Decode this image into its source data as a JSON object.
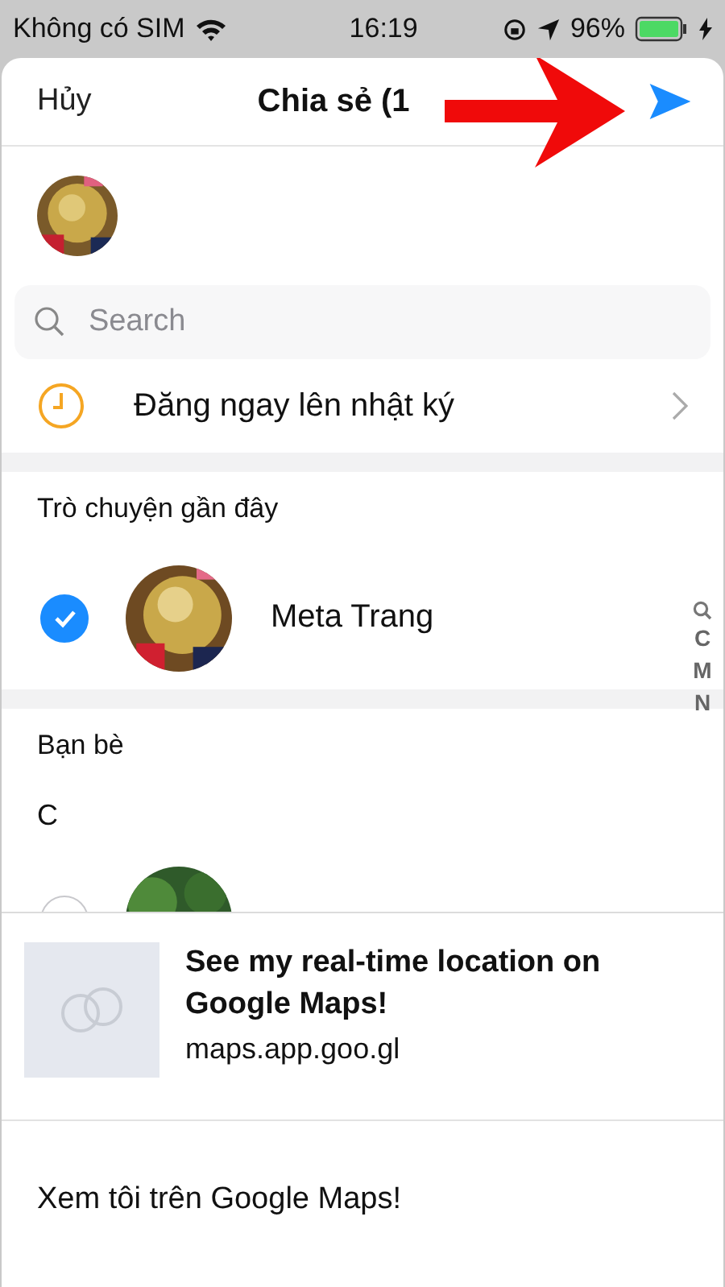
{
  "status_bar": {
    "carrier": "Không có SIM",
    "time": "16:19",
    "battery": "96%"
  },
  "header": {
    "cancel": "Hủy",
    "title": "Chia sẻ (1"
  },
  "search": {
    "placeholder": "Search"
  },
  "post_option": {
    "label": "Đăng ngay lên nhật ký"
  },
  "recent": {
    "title": "Trò chuyện gần đây",
    "contacts": [
      {
        "name": "Meta Trang",
        "selected": true
      }
    ]
  },
  "friends": {
    "title": "Bạn bè",
    "groups": [
      {
        "letter": "C",
        "contacts": [
          {
            "selected": false
          }
        ]
      }
    ]
  },
  "index": [
    "C",
    "M",
    "N"
  ],
  "preview": {
    "title": "See my real-time location on Google Maps!",
    "domain": "maps.app.goo.gl",
    "message": "Xem tôi trên Google Maps!"
  }
}
